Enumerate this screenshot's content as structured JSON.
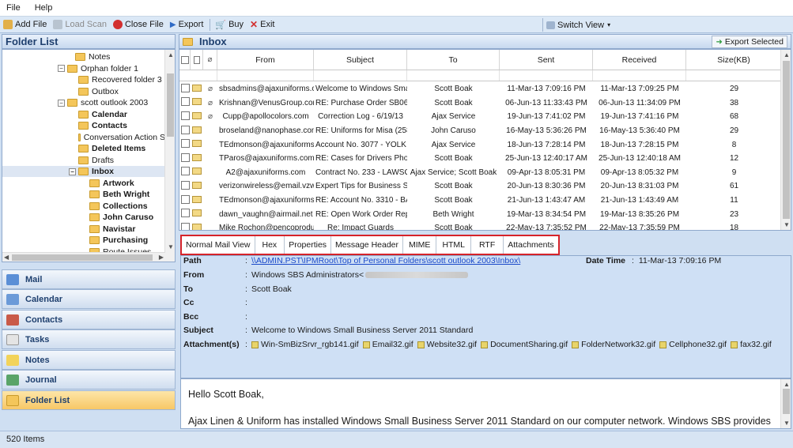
{
  "menu": {
    "file": "File",
    "help": "Help"
  },
  "toolbar": {
    "add_file": "Add File",
    "load_scan": "Load Scan",
    "close_file": "Close File",
    "export": "Export",
    "buy": "Buy",
    "exit": "Exit",
    "switch_view": "Switch View"
  },
  "left": {
    "title": "Folder List",
    "tree": [
      {
        "label": "Notes",
        "bold": false
      },
      {
        "label": "Orphan folder 1",
        "bold": false
      },
      {
        "label": "Recovered folder 3",
        "bold": false
      },
      {
        "label": "Outbox",
        "bold": false
      },
      {
        "label": "scott outlook 2003",
        "bold": false
      },
      {
        "label": "Calendar",
        "bold": true
      },
      {
        "label": "Contacts",
        "bold": true
      },
      {
        "label": "Conversation Action S",
        "bold": false
      },
      {
        "label": "Deleted Items",
        "bold": true
      },
      {
        "label": "Drafts",
        "bold": false
      },
      {
        "label": "Inbox",
        "bold": true
      },
      {
        "label": "Artwork",
        "bold": true
      },
      {
        "label": "Beth Wright",
        "bold": true
      },
      {
        "label": "Collections",
        "bold": true
      },
      {
        "label": "John Caruso",
        "bold": true
      },
      {
        "label": "Navistar",
        "bold": true
      },
      {
        "label": "Purchasing",
        "bold": true
      },
      {
        "label": "Route Issues",
        "bold": false
      }
    ],
    "nav": [
      "Mail",
      "Calendar",
      "Contacts",
      "Tasks",
      "Notes",
      "Journal",
      "Folder List"
    ]
  },
  "right": {
    "title": "Inbox",
    "export_selected": "Export Selected",
    "columns": [
      "From",
      "Subject",
      "To",
      "Sent",
      "Received",
      "Size(KB)"
    ],
    "rows": [
      {
        "from": "sbsadmins@ajaxuniforms.com",
        "subject": "Welcome to Windows Small ...",
        "to": "Scott Boak",
        "sent": "11-Mar-13 7:09:16 PM",
        "received": "11-Mar-13 7:09:25 PM",
        "size": "29",
        "attach": true
      },
      {
        "from": "Krishnan@VenusGroup.com",
        "subject": "RE: Purchase Order SB060...",
        "to": "Scott Boak",
        "sent": "06-Jun-13 11:33:43 PM",
        "received": "06-Jun-13 11:34:09 PM",
        "size": "38",
        "attach": true
      },
      {
        "from": "Cupp@apollocolors.com",
        "subject": "Correction Log - 6/19/13",
        "to": "Ajax Service",
        "sent": "19-Jun-13 7:41:02 PM",
        "received": "19-Jun-13 7:41:16 PM",
        "size": "68",
        "attach": true
      },
      {
        "from": "broseland@nanophase.com",
        "subject": "RE: Uniforms for Misa (258)",
        "to": "John Caruso",
        "sent": "16-May-13 5:36:26 PM",
        "received": "16-May-13 5:36:40 PM",
        "size": "29",
        "attach": false
      },
      {
        "from": "TEdmonson@ajaxuniforms.c...",
        "subject": "Account No. 3077 - YOLK S...",
        "to": "Ajax Service",
        "sent": "18-Jun-13 7:28:14 PM",
        "received": "18-Jun-13 7:28:15 PM",
        "size": "8",
        "attach": false
      },
      {
        "from": "TParos@ajaxuniforms.com",
        "subject": "RE: Cases for Drivers Phones",
        "to": "Scott Boak",
        "sent": "25-Jun-13 12:40:17 AM",
        "received": "25-Jun-13 12:40:18 AM",
        "size": "12",
        "attach": false
      },
      {
        "from": "A2@ajaxuniforms.com",
        "subject": "Contract No. 233 - LAWSO...",
        "to": "Ajax Service; Scott Boak",
        "sent": "09-Apr-13 8:05:31 PM",
        "received": "09-Apr-13 8:05:32 PM",
        "size": "9",
        "attach": false
      },
      {
        "from": "verizonwireless@email.vzws...",
        "subject": "Expert Tips for Business Suc...",
        "to": "Scott Boak",
        "sent": "20-Jun-13 8:30:36 PM",
        "received": "20-Jun-13 8:31:03 PM",
        "size": "61",
        "attach": false
      },
      {
        "from": "TEdmonson@ajaxuniforms.c...",
        "subject": "RE: Account No. 3310 - BA...",
        "to": "Scott Boak",
        "sent": "21-Jun-13 1:43:47 AM",
        "received": "21-Jun-13 1:43:49 AM",
        "size": "11",
        "attach": false
      },
      {
        "from": "dawn_vaughn@airmail.net",
        "subject": "RE: Open Work Order Report",
        "to": "Beth Wright",
        "sent": "19-Mar-13 8:34:54 PM",
        "received": "19-Mar-13 8:35:26 PM",
        "size": "23",
        "attach": false
      },
      {
        "from": "Mike Rochon@pencoprodu...",
        "subject": "Re: Impact Guards",
        "to": "Scott Boak",
        "sent": "22-May-13 7:35:52 PM",
        "received": "22-May-13 7:35:59 PM",
        "size": "18",
        "attach": false
      }
    ],
    "tabs": [
      "Normal Mail View",
      "Hex",
      "Properties",
      "Message Header",
      "MIME",
      "HTML",
      "RTF",
      "Attachments"
    ],
    "header": {
      "path_label": "Path",
      "path_value": "\\\\ADMIN.PST\\IPMRoot\\Top of Personal Folders\\scott outlook 2003\\Inbox\\",
      "datetime_label": "Date Time",
      "datetime_value": "11-Mar-13 7:09:16 PM",
      "from_label": "From",
      "from_value": "Windows SBS Administrators<",
      "to_label": "To",
      "to_value": "Scott Boak",
      "cc_label": "Cc",
      "bcc_label": "Bcc",
      "subject_label": "Subject",
      "subject_value": "Welcome to Windows Small Business Server 2011 Standard",
      "attachments_label": "Attachment(s)",
      "attachments": [
        "Win-SmBizSrvr_rgb141.gif",
        "Email32.gif",
        "Website32.gif",
        "DocumentSharing.gif",
        "FolderNetwork32.gif",
        "Cellphone32.gif",
        "fax32.gif"
      ]
    },
    "body": {
      "greeting": "Hello Scott Boak,",
      "line1": "Ajax Linen & Uniform has installed Windows Small Business Server 2011 Standard on our computer network. Windows SBS provides"
    }
  },
  "status": "520 Items"
}
